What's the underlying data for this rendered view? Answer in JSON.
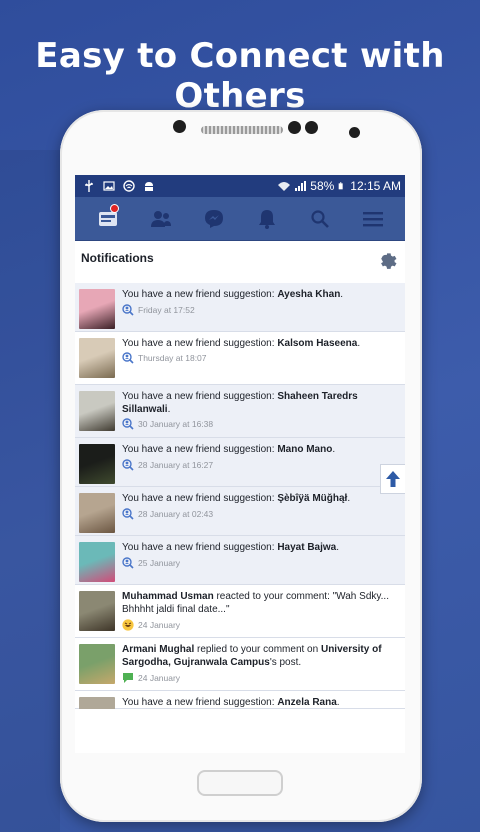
{
  "headline": "Easy to Connect with Others",
  "status_bar": {
    "battery": "58%",
    "time": "12:15 AM",
    "left_icons": [
      "usb-icon",
      "image-icon",
      "vpn-shield-icon",
      "android-icon"
    ],
    "right_icons": [
      "wifi-icon",
      "signal-icon",
      "battery-icon"
    ]
  },
  "nav": {
    "items": [
      "news-feed-icon",
      "friend-requests-icon",
      "messages-icon",
      "notifications-icon",
      "search-icon",
      "menu-icon"
    ]
  },
  "page": {
    "title": "Notifications"
  },
  "notifications": [
    {
      "prefix": "You have a new friend suggestion: ",
      "name": "Ayesha Khan",
      "suffix": ".",
      "time": "Friday at 17:52",
      "icon": "friend-suggestion-icon",
      "unread": true
    },
    {
      "prefix": "You have a new friend suggestion: ",
      "name": "Kalsom Haseena",
      "suffix": ".",
      "time": "Thursday at 18:07",
      "icon": "friend-suggestion-icon",
      "unread": false
    },
    {
      "prefix": "You have a new friend suggestion: ",
      "name": "Shaheen Taredrs Sillanwali",
      "suffix": ".",
      "time": "30 January at 16:38",
      "icon": "friend-suggestion-icon",
      "unread": true
    },
    {
      "prefix": "You have a new friend suggestion: ",
      "name": "Mano Mano",
      "suffix": ".",
      "time": "28 January at 16:27",
      "icon": "friend-suggestion-icon",
      "unread": true
    },
    {
      "prefix": "You have a new friend suggestion: ",
      "name": "Şèbîÿä Müğhął",
      "suffix": ".",
      "time": "28 January at 02:43",
      "icon": "friend-suggestion-icon",
      "unread": true
    },
    {
      "prefix": "You have a new friend suggestion: ",
      "name": "Hayat Bajwa",
      "suffix": ".",
      "time": "25 January",
      "icon": "friend-suggestion-icon",
      "unread": true
    },
    {
      "name": "Muhammad Usman",
      "prefix": "",
      "suffix": " reacted to your comment: \"Wah Sdky... Bhhhht jaldi final date...\"",
      "time": "24 January",
      "icon": "haha-reaction-icon",
      "unread": false
    },
    {
      "name": "Armani Mughal",
      "prefix": "",
      "suffix": " replied to your comment on ",
      "name2": "University of Sargodha, Gujranwala Campus",
      "suffix2": "'s post.",
      "time": "24 January",
      "icon": "comment-icon",
      "unread": false
    },
    {
      "prefix": "You have a new friend suggestion: ",
      "name": "Anzela Rana",
      "suffix": ".",
      "time": "",
      "icon": "friend-suggestion-icon",
      "unread": false
    }
  ],
  "colors": {
    "background": "#3b5aa8",
    "nav_bar": "#3b5998",
    "status_bar": "#223c7e",
    "unread_row": "#edf0f7",
    "badge": "#e02424"
  }
}
